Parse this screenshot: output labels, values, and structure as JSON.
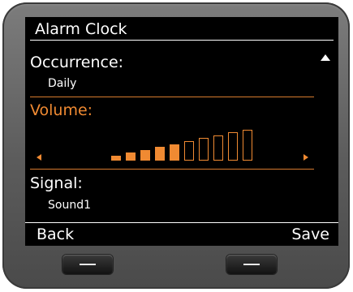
{
  "title": "Alarm Clock",
  "occurrence": {
    "label": "Occurrence:",
    "value": "Daily"
  },
  "volume": {
    "label": "Volume:",
    "level": 5,
    "max": 10
  },
  "signal": {
    "label": "Signal:",
    "value": "Sound1"
  },
  "softkeys": {
    "left": "Back",
    "right": "Save"
  },
  "icons": {
    "scroll": "scroll-up-icon",
    "left": "arrow-left-icon",
    "right": "arrow-right-icon"
  },
  "colors": {
    "accent": "#f08a32",
    "screen_bg": "#000000",
    "text": "#ffffff",
    "bezel": "#666666"
  }
}
